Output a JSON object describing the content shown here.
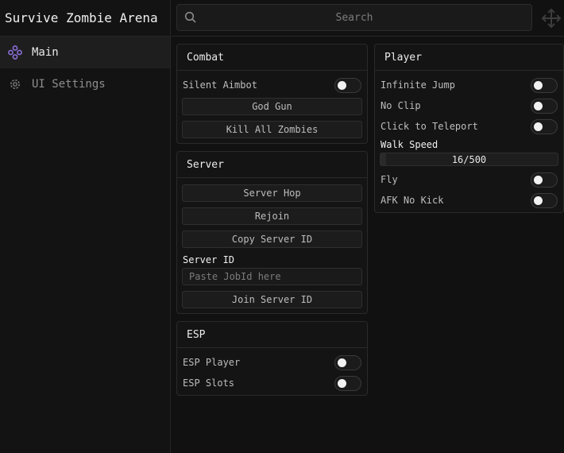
{
  "app": {
    "title": "Survive Zombie Arena"
  },
  "sidebar": {
    "items": [
      {
        "label": "Main",
        "icon": "diamond-dots-icon",
        "active": true
      },
      {
        "label": "UI Settings",
        "icon": "gear-icon",
        "active": false
      }
    ]
  },
  "search": {
    "placeholder": "Search"
  },
  "combat": {
    "title": "Combat",
    "silent_aimbot": {
      "label": "Silent Aimbot",
      "on": false
    },
    "god_gun_label": "God Gun",
    "kill_all_label": "Kill All Zombies"
  },
  "server": {
    "title": "Server",
    "hop_label": "Server Hop",
    "rejoin_label": "Rejoin",
    "copy_id_label": "Copy Server ID",
    "server_id_label": "Server ID",
    "jobid_placeholder": "Paste JobId here",
    "join_label": "Join Server ID"
  },
  "esp": {
    "title": "ESP",
    "player": {
      "label": "ESP Player",
      "on": false
    },
    "slots": {
      "label": "ESP Slots",
      "on": false
    }
  },
  "player": {
    "title": "Player",
    "infinite_jump": {
      "label": "Infinite Jump",
      "on": false
    },
    "no_clip": {
      "label": "No Clip",
      "on": false
    },
    "click_teleport": {
      "label": "Click to Teleport",
      "on": false
    },
    "walk_speed": {
      "label": "Walk Speed",
      "value": 16,
      "max": 500,
      "display": "16/500"
    },
    "fly": {
      "label": "Fly",
      "on": false
    },
    "afk": {
      "label": "AFK No Kick",
      "on": false
    }
  },
  "colors": {
    "accent": "#8a6fd6",
    "background": "#111111",
    "panel": "#141414"
  }
}
